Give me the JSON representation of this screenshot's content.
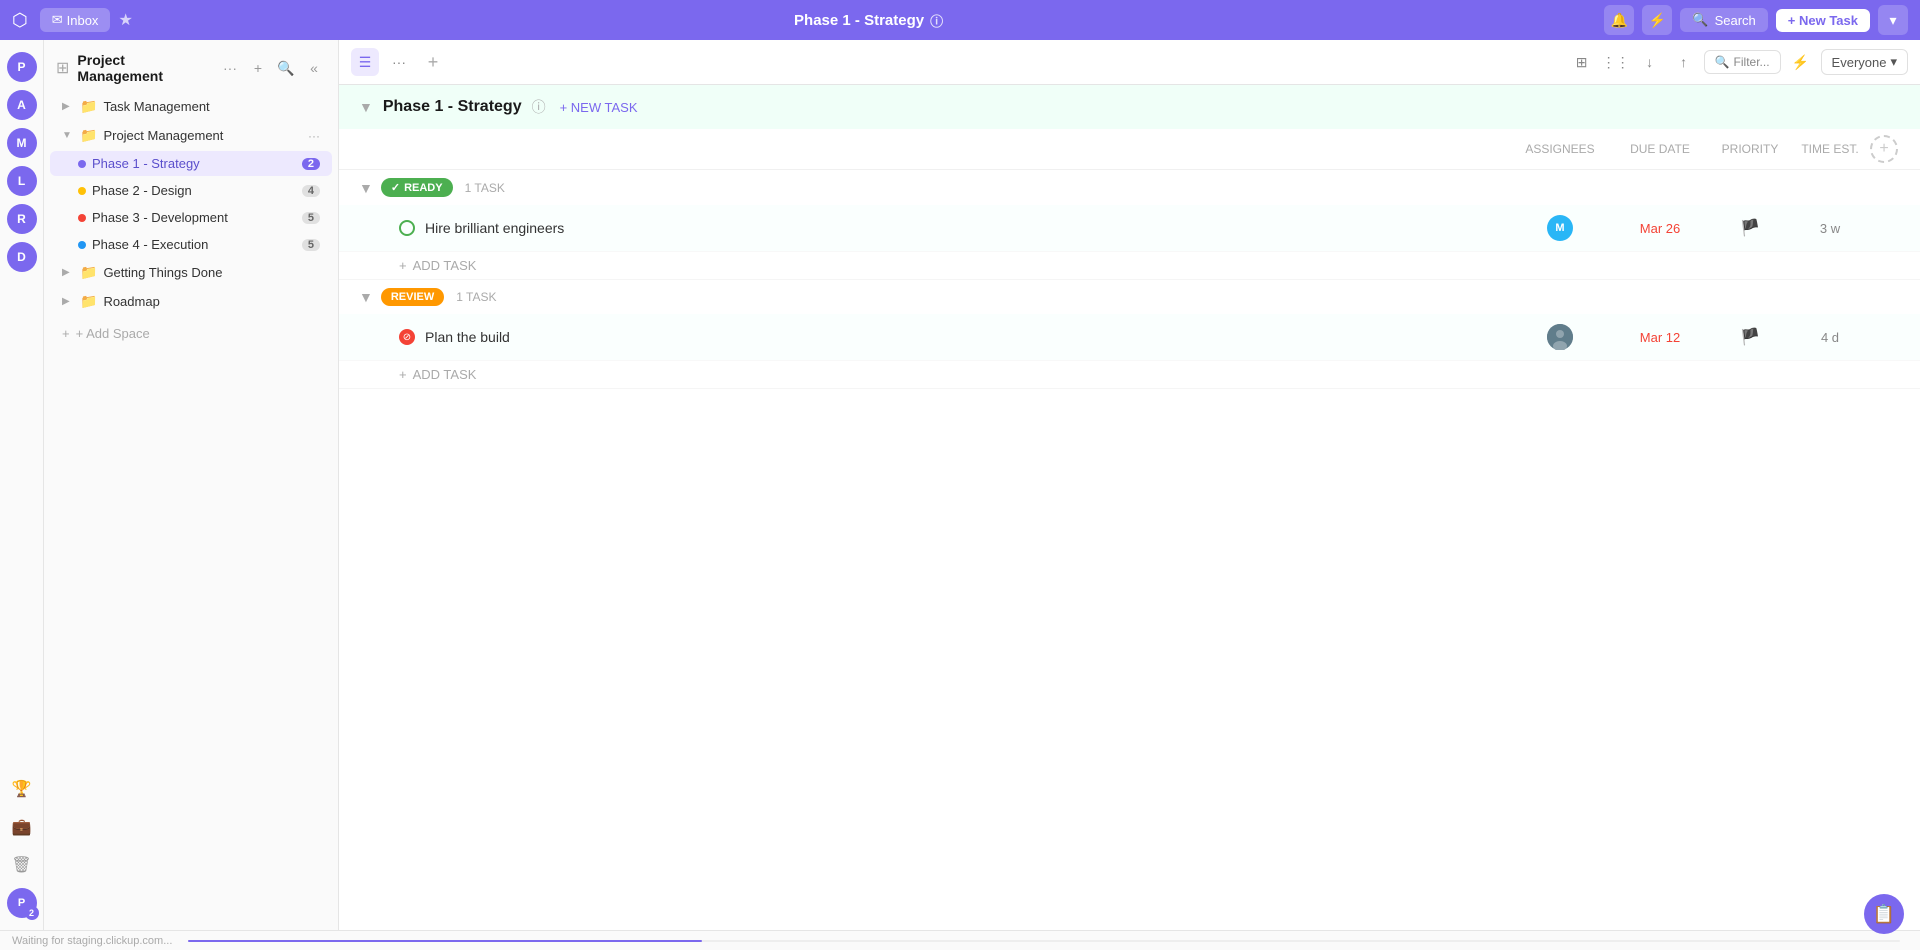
{
  "topNav": {
    "logo": "⬡",
    "inbox_label": "Inbox",
    "star_icon": "★",
    "title": "Phase 1 - Strategy",
    "info_icon": "ⓘ",
    "search_label": "Search",
    "new_task_label": "+ New Task",
    "notification_icon": "🔔",
    "lightning_icon": "⚡"
  },
  "sidebar": {
    "project_title": "Project Management",
    "sections": [
      {
        "label": "Task Management",
        "type": "folder",
        "indent": 0
      },
      {
        "label": "Project Management",
        "type": "folder",
        "indent": 0,
        "expanded": true
      },
      {
        "label": "Phase 1 - Strategy",
        "type": "item",
        "dot_color": "#7B68EE",
        "count": "2",
        "active": true,
        "indent": 1
      },
      {
        "label": "Phase 2 - Design",
        "type": "item",
        "dot_color": "#FFC107",
        "count": "4",
        "active": false,
        "indent": 1
      },
      {
        "label": "Phase 3 - Development",
        "type": "item",
        "dot_color": "#f44336",
        "count": "5",
        "active": false,
        "indent": 1
      },
      {
        "label": "Phase 4 - Execution",
        "type": "item",
        "dot_color": "#2196F3",
        "count": "5",
        "active": false,
        "indent": 1
      },
      {
        "label": "Getting Things Done",
        "type": "folder",
        "indent": 0
      },
      {
        "label": "Roadmap",
        "type": "folder",
        "indent": 0
      }
    ],
    "add_space_label": "+ Add Space"
  },
  "toolbar": {
    "view_icon": "☰",
    "more_icon": "···",
    "add_icon": "+",
    "collapse_icon": "«",
    "filter_label": "Filter...",
    "everyone_label": "Everyone",
    "icons": {
      "grid": "⊞",
      "columns": "⋮⋮",
      "download": "↓",
      "export": "↑"
    }
  },
  "content": {
    "phase_title": "Phase 1 - Strategy",
    "new_task_label": "+ NEW TASK",
    "columns": {
      "assignees": "ASSIGNEES",
      "due_date": "DUE DATE",
      "priority": "PRIORITY",
      "time_est": "TIME EST."
    },
    "status_groups": [
      {
        "status": "READY",
        "status_type": "ready",
        "task_count": "1 TASK",
        "check_icon": "✓",
        "tasks": [
          {
            "name": "Hire brilliant engineers",
            "assignee_color": "#29B6F6",
            "assignee_letter": "M",
            "due_date": "Mar 26",
            "due_date_color": "#f44336",
            "priority_flag": "🏳",
            "time_est": "3 w",
            "status_type": "open"
          }
        ]
      },
      {
        "status": "REVIEW",
        "status_type": "review",
        "task_count": "1 TASK",
        "tasks": [
          {
            "name": "Plan the build",
            "assignee_color": "#607D8B",
            "assignee_letter": "",
            "due_date": "Mar 12",
            "due_date_color": "#f44336",
            "priority_flag": "🏳",
            "time_est": "4 d",
            "status_type": "blocked"
          }
        ]
      }
    ]
  },
  "avatars": [
    {
      "letter": "P",
      "color": "#7B68EE"
    },
    {
      "letter": "A",
      "color": "#7B68EE"
    },
    {
      "letter": "M",
      "color": "#7B68EE"
    },
    {
      "letter": "L",
      "color": "#7B68EE"
    },
    {
      "letter": "R",
      "color": "#7B68EE"
    },
    {
      "letter": "D",
      "color": "#7B68EE"
    }
  ],
  "statusBar": {
    "waiting_text": "Waiting for staging.clickup.com..."
  }
}
